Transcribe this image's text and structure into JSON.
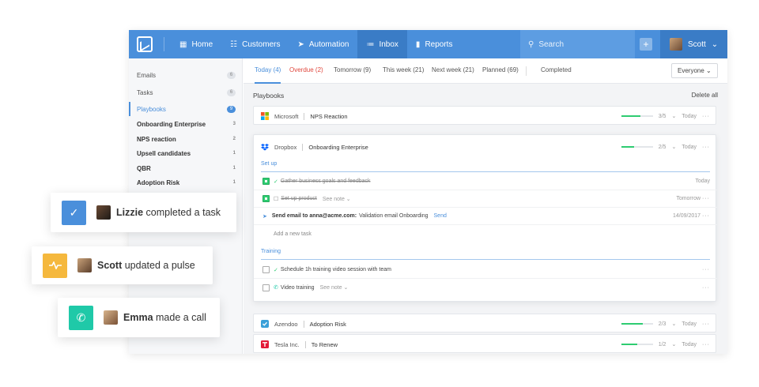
{
  "topbar": {
    "nav": [
      {
        "label": "Home",
        "icon": "grid-icon"
      },
      {
        "label": "Customers",
        "icon": "customers-icon"
      },
      {
        "label": "Automation",
        "icon": "send-icon"
      },
      {
        "label": "Inbox",
        "icon": "inbox-icon",
        "active": true
      },
      {
        "label": "Reports",
        "icon": "bar-chart-icon"
      }
    ],
    "search_placeholder": "Search",
    "plus_label": "+",
    "user_name": "Scott"
  },
  "sidebar": {
    "items": [
      {
        "label": "Emails",
        "count": "6"
      },
      {
        "label": "Tasks",
        "count": "6"
      },
      {
        "label": "Playbooks",
        "count": "9"
      },
      {
        "label": "Onboarding Enterprise",
        "count": "3"
      },
      {
        "label": "NPS reaction",
        "count": "2"
      },
      {
        "label": "Upsell candidates",
        "count": "1"
      },
      {
        "label": "QBR",
        "count": "1"
      },
      {
        "label": "Adoption Risk",
        "count": "1"
      }
    ]
  },
  "tabs": [
    {
      "label": "Today (4)"
    },
    {
      "label": "Overdue (2)"
    },
    {
      "label": "Tomorrow (9)"
    },
    {
      "label": "This week (21)"
    },
    {
      "label": "Next week (21)"
    },
    {
      "label": "Planned (69)"
    },
    {
      "label": "Completed"
    }
  ],
  "filter_label": "Everyone",
  "section_title": "Playbooks",
  "delete_all": "Delete all",
  "playbooks": [
    {
      "company": "Microsoft",
      "name": "NPS Reaction",
      "progress_text": "3/5",
      "progress": 0.6,
      "due": "Today",
      "logo_color": "#f35325"
    },
    {
      "company": "Dropbox",
      "name": "Onboarding Enterprise",
      "progress_text": "2/5",
      "progress": 0.4,
      "due": "Today",
      "logo_color": "#0061ff"
    },
    {
      "company": "Azendoo",
      "name": "Adoption Risk",
      "progress_text": "2/3",
      "progress": 0.67,
      "due": "Today",
      "logo_color": "#3aa0d8"
    },
    {
      "company": "Tesla Inc.",
      "name": "To Renew",
      "progress_text": "1/2",
      "progress": 0.5,
      "due": "Today",
      "logo_color": "#e31937"
    }
  ],
  "groups": {
    "setup": "Set up",
    "training": "Training"
  },
  "tasks": {
    "t1": {
      "text": "Gather business goals and feedback",
      "due": "Today"
    },
    "t2": {
      "text": "Set up product",
      "note": "See note",
      "due": "Tomorrow"
    },
    "t3": {
      "prefix": "Send email to anna@acme.com:",
      "text": "Validation email Onboarding",
      "action": "Send",
      "due": "14/09/2017"
    },
    "t4": {
      "text": "Add a new task"
    },
    "t5": {
      "text": "Schedule 1h training video session with team"
    },
    "t6": {
      "text": "Video training",
      "note": "See note"
    }
  },
  "notifications": [
    {
      "name": "Lizzie",
      "text": "completed a task",
      "color": "#4a8fdb"
    },
    {
      "name": "Scott",
      "text": "updated a pulse",
      "color": "#f5b83d"
    },
    {
      "name": "Emma",
      "text": "made a call",
      "color": "#1fc9a8"
    }
  ]
}
